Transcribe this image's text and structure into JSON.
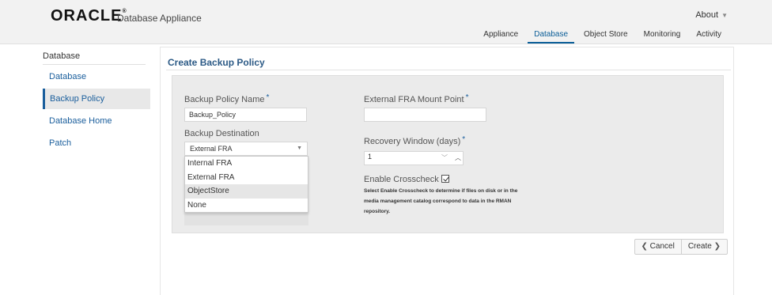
{
  "header": {
    "brand": "ORACLE",
    "product_name": "Database Appliance",
    "about_label": "About",
    "nav_tabs": [
      "Appliance",
      "Database",
      "Object Store",
      "Monitoring",
      "Activity"
    ],
    "active_tab": "Database"
  },
  "sidebar": {
    "title": "Database",
    "items": [
      "Database",
      "Backup Policy",
      "Database Home",
      "Patch"
    ],
    "active_item": "Backup Policy"
  },
  "form": {
    "title": "Create Backup Policy",
    "policy_name_label": "Backup Policy Name",
    "policy_name_value": "Backup_Policy",
    "destination_label": "Backup Destination",
    "destination_value": "External FRA",
    "destination_options": [
      "Internal FRA",
      "External FRA",
      "ObjectStore",
      "None"
    ],
    "hovered_option": "ObjectStore",
    "fra_mount_label": "External FRA Mount Point",
    "fra_mount_value": "",
    "recovery_window_label": "Recovery Window (days)",
    "recovery_window_value": "1",
    "crosscheck_label": "Enable Crosscheck",
    "crosscheck_checked": true,
    "crosscheck_help": "Select Enable Crosscheck to determine if files on disk or in the media management catalog correspond to data in the RMAN repository.",
    "required_marker": "*"
  },
  "actions": {
    "cancel_label": "Cancel",
    "create_label": "Create"
  },
  "colors": {
    "accent": "#1a5e9c",
    "title": "#2c5a86"
  }
}
